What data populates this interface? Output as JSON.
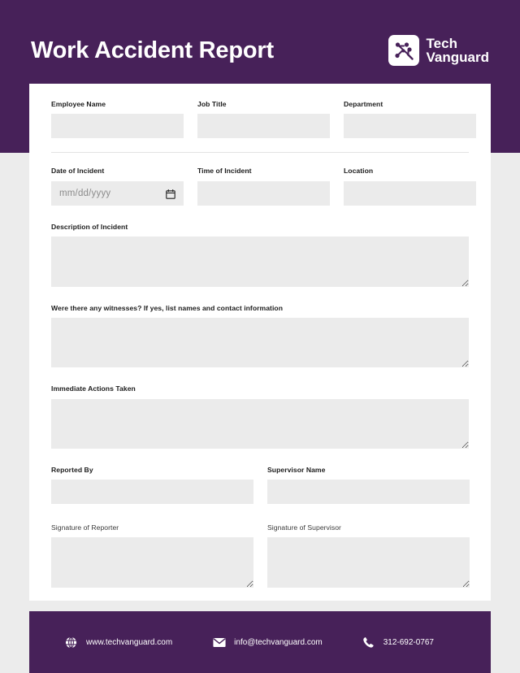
{
  "document": {
    "title": "Work Accident Report",
    "theme_color": "#472159",
    "field_fill_color": "#ebebeb",
    "page_background": "#ececec"
  },
  "brand": {
    "name_line1": "Tech",
    "name_line2": "Vanguard",
    "logo_icon": "circuit-nodes-icon"
  },
  "form": {
    "row_identity": [
      {
        "label": "Employee Name",
        "value": ""
      },
      {
        "label": "Job Title",
        "value": ""
      },
      {
        "label": "Department",
        "value": ""
      }
    ],
    "row_incident": [
      {
        "label": "Date of Incident",
        "value": "",
        "placeholder": "mm/dd/yyyy",
        "type": "date"
      },
      {
        "label": "Time of Incident",
        "value": ""
      },
      {
        "label": "Location",
        "value": ""
      }
    ],
    "description": {
      "label": "Description of Incident",
      "value": ""
    },
    "witnesses": {
      "label": "Were there any witnesses? If yes, list names and contact information",
      "value": ""
    },
    "actions": {
      "label": "Immediate Actions Taken",
      "value": ""
    },
    "row_reporters": [
      {
        "label": "Reported By",
        "value": ""
      },
      {
        "label": "Supervisor Name",
        "value": ""
      }
    ],
    "row_signatures": [
      {
        "label": "Signature of Reporter",
        "value": ""
      },
      {
        "label": "Signature of Supervisor",
        "value": ""
      }
    ]
  },
  "footer": {
    "contacts": [
      {
        "icon": "globe-icon",
        "text": "www.techvanguard.com"
      },
      {
        "icon": "envelope-icon",
        "text": "info@techvanguard.com"
      },
      {
        "icon": "phone-icon",
        "text": "312-692-0767"
      }
    ]
  }
}
